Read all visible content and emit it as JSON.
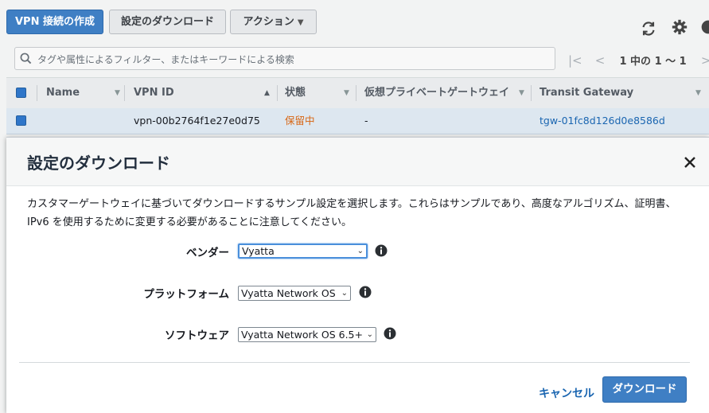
{
  "toolbar": {
    "create_vpn_label": "VPN 接続の作成",
    "download_config_label": "設定のダウンロード",
    "actions_label": "アクション",
    "refresh_icon": "refresh-icon",
    "settings_icon": "gear-icon"
  },
  "search": {
    "placeholder": "タグや属性によるフィルター、またはキーワードによる検索"
  },
  "pagination": {
    "text": "1 中の 1 〜 1",
    "first": "|<",
    "prev": "<",
    "next": ">",
    "last": ">|"
  },
  "table": {
    "columns": [
      "Name",
      "VPN ID",
      "状態",
      "仮想プライベートゲートウェイ",
      "Transit Gateway"
    ],
    "rows": [
      {
        "name": "",
        "vpn_id": "vpn-00b2764f1e27e0d75",
        "state": "保留中",
        "vgw": "-",
        "tgw": "tgw-01fc8d126d0e8586d"
      }
    ]
  },
  "modal": {
    "title": "設定のダウンロード",
    "description": "カスタマーゲートウェイに基づいてダウンロードするサンプル設定を選択します。これらはサンプルであり、高度なアルゴリズム、証明書、IPv6 を使用するために変更する必要があることに注意してください。",
    "fields": {
      "vendor": {
        "label": "ベンダー",
        "value": "Vyatta"
      },
      "platform": {
        "label": "プラットフォーム",
        "value": "Vyatta Network OS"
      },
      "software": {
        "label": "ソフトウェア",
        "value": "Vyatta Network OS 6.5+"
      }
    },
    "cancel_label": "キャンセル",
    "download_label": "ダウンロード"
  },
  "colors": {
    "primary": "#3f7fc4",
    "link": "#1b66b1",
    "pending": "#d86613"
  }
}
